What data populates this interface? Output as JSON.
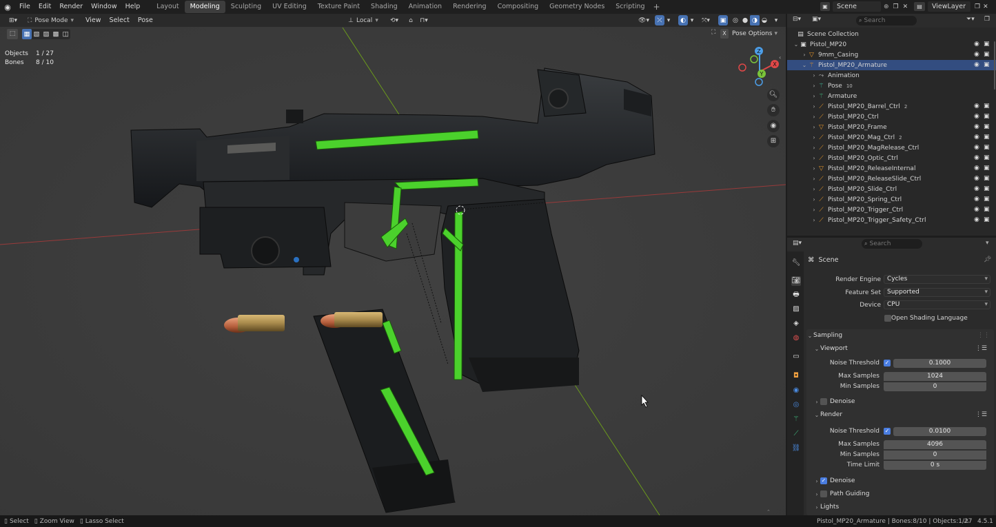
{
  "menus": [
    "File",
    "Edit",
    "Render",
    "Window",
    "Help"
  ],
  "workspaces": [
    "Layout",
    "Modeling",
    "Sculpting",
    "UV Editing",
    "Texture Paint",
    "Shading",
    "Animation",
    "Rendering",
    "Compositing",
    "Geometry Nodes",
    "Scripting"
  ],
  "active_workspace": "Modeling",
  "scene_name": "Scene",
  "view_layer": "ViewLayer",
  "header": {
    "mode": "Pose Mode",
    "view": "View",
    "select": "Select",
    "pose": "Pose",
    "orientation": "Local",
    "pose_options": "Pose Options"
  },
  "overlay": {
    "objects_label": "Objects",
    "objects_value": "1 / 27",
    "bones_label": "Bones",
    "bones_value": "8 / 10"
  },
  "gizmo": {
    "z": "Z",
    "x": "X",
    "y": "Y"
  },
  "outliner": {
    "search_placeholder": "Search",
    "collection": "Scene Collection",
    "root": "Pistol_MP20",
    "items": [
      {
        "name": "9mm_Casing",
        "icon": "mesh"
      },
      {
        "name": "Pistol_MP20_Armature",
        "icon": "armature"
      },
      {
        "name": "Animation",
        "icon": "anim"
      },
      {
        "name": "Pose",
        "icon": "pose",
        "badge": "10"
      },
      {
        "name": "Armature",
        "icon": "armdata"
      },
      {
        "name": "Pistol_MP20_Barrel_Ctrl",
        "icon": "bone",
        "badge": "2"
      },
      {
        "name": "Pistol_MP20_Ctrl",
        "icon": "bone"
      },
      {
        "name": "Pistol_MP20_Frame",
        "icon": "mesh"
      },
      {
        "name": "Pistol_MP20_Mag_Ctrl",
        "icon": "bone",
        "badge": "2"
      },
      {
        "name": "Pistol_MP20_MagRelease_Ctrl",
        "icon": "bone"
      },
      {
        "name": "Pistol_MP20_Optic_Ctrl",
        "icon": "bone"
      },
      {
        "name": "Pistol_MP20_ReleaseInternal",
        "icon": "mesh"
      },
      {
        "name": "Pistol_MP20_ReleaseSlide_Ctrl",
        "icon": "bone"
      },
      {
        "name": "Pistol_MP20_Slide_Ctrl",
        "icon": "bone"
      },
      {
        "name": "Pistol_MP20_Spring_Ctrl",
        "icon": "bone"
      },
      {
        "name": "Pistol_MP20_Trigger_Ctrl",
        "icon": "bone"
      },
      {
        "name": "Pistol_MP20_Trigger_Safety_Ctrl",
        "icon": "bone"
      }
    ]
  },
  "properties": {
    "search_placeholder": "Search",
    "context": "Scene",
    "render_engine_label": "Render Engine",
    "render_engine": "Cycles",
    "feature_set_label": "Feature Set",
    "feature_set": "Supported",
    "device_label": "Device",
    "device": "CPU",
    "osl_label": "Open Shading Language",
    "sampling": "Sampling",
    "viewport": "Viewport",
    "vp_noise_label": "Noise Threshold",
    "vp_noise": "0.1000",
    "vp_max_label": "Max Samples",
    "vp_max": "1024",
    "vp_min_label": "Min Samples",
    "vp_min": "0",
    "denoise": "Denoise",
    "render": "Render",
    "r_noise_label": "Noise Threshold",
    "r_noise": "0.0100",
    "r_max_label": "Max Samples",
    "r_max": "4096",
    "r_min_label": "Min Samples",
    "r_min": "0",
    "r_time_label": "Time Limit",
    "r_time": "0 s",
    "denoise2": "Denoise",
    "path_guiding": "Path Guiding",
    "lights": "Lights"
  },
  "status": {
    "select": "Select",
    "zoom": "Zoom View",
    "lasso": "Lasso Select",
    "info": "Pistol_MP20_Armature | Bones:8/10 | Objects:1/27",
    "version": "4.5.1"
  },
  "colors": {
    "accent": "#4772b3",
    "bone": "#3fd128",
    "selection_row": "#334d80"
  }
}
